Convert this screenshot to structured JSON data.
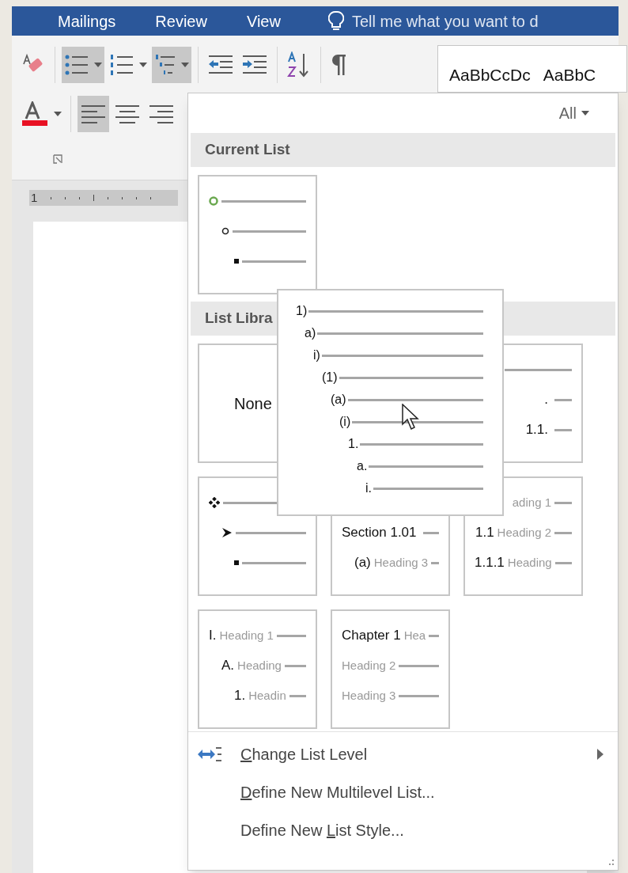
{
  "ribbon": {
    "tabs": [
      {
        "label": "Mailings"
      },
      {
        "label": "Review"
      },
      {
        "label": "View"
      }
    ],
    "tell_me": {
      "placeholder": "Tell me what you want to d"
    },
    "row1": [
      {
        "kind": "clear-format"
      },
      {
        "kind": "separator"
      },
      {
        "kind": "bullets",
        "selected": true
      },
      {
        "kind": "numbering",
        "selected": false
      },
      {
        "kind": "multilevel",
        "selected": true
      },
      {
        "kind": "separator"
      },
      {
        "kind": "decrease-indent"
      },
      {
        "kind": "increase-indent"
      },
      {
        "kind": "separator"
      },
      {
        "kind": "sort"
      },
      {
        "kind": "separator"
      },
      {
        "kind": "pilcrow"
      }
    ],
    "row2": [
      {
        "kind": "font-color"
      },
      {
        "kind": "separator"
      },
      {
        "kind": "align-left",
        "selected": true
      },
      {
        "kind": "align-center",
        "selected": false
      },
      {
        "kind": "align-right",
        "selected": false
      }
    ],
    "styles": [
      "AaBbCcDc",
      "AaBbC"
    ]
  },
  "ruler": {
    "label": "1"
  },
  "menu": {
    "filter": "All",
    "current_header": "Current List",
    "current_list": {
      "rows": [
        {
          "kind": "ring-green",
          "children": [
            {
              "kind": "ring",
              "children": [
                {
                  "kind": "square"
                }
              ]
            }
          ]
        }
      ]
    },
    "library_header": "List Libra",
    "library": [
      {
        "kind": "none",
        "label": "None"
      },
      {
        "kind": "covered"
      },
      {
        "kind": "rows-right",
        "rows": [
          {},
          {
            "number": "."
          },
          {
            "number": "1.1."
          }
        ]
      },
      {
        "kind": "rows",
        "rows": [
          {
            "kind": "diamond",
            "children": [
              {
                "kind": "arrow",
                "children": [
                  {
                    "kind": "square"
                  }
                ]
              }
            ]
          }
        ]
      },
      {
        "kind": "rows",
        "rows": [
          {},
          {
            "number": "Section 1.01",
            "children": [
              {
                "number": "(a)",
                "heading": "Heading 3"
              }
            ]
          }
        ]
      },
      {
        "kind": "rows-right",
        "rows": [
          {
            "heading": "ading 1"
          },
          {
            "number": "1.1",
            "heading": "Heading 2"
          },
          {
            "number": "1.1.1",
            "heading": "Heading"
          }
        ]
      },
      {
        "kind": "rows",
        "rows": [
          {
            "number": "I.",
            "heading": "Heading 1",
            "children": [
              {
                "number": "A.",
                "heading": "Heading",
                "children": [
                  {
                    "number": "1.",
                    "heading": "Headin"
                  }
                ]
              }
            ]
          }
        ]
      },
      {
        "kind": "rows",
        "rows": [
          {
            "number": "Chapter 1",
            "heading": "Hea"
          },
          {
            "heading": "Heading 2"
          },
          {
            "heading": "Heading 3"
          }
        ]
      }
    ],
    "actions": [
      {
        "kind": "submenu",
        "accel": "C",
        "after": "hange List Level"
      },
      {
        "kind": "plain",
        "accel": "D",
        "after": "efine New Multilevel List..."
      },
      {
        "kind": "plain",
        "before": "Define New ",
        "accel": "L",
        "after": "ist Style..."
      }
    ]
  },
  "preview": {
    "levels": [
      {
        "number": "1)",
        "children": [
          {
            "number": "a)",
            "children": [
              {
                "number": "i)",
                "children": [
                  {
                    "number": "(1)",
                    "children": [
                      {
                        "number": "(a)",
                        "children": [
                          {
                            "number": "(i)",
                            "children": [
                              {
                                "number": "1.",
                                "children": [
                                  {
                                    "number": "a.",
                                    "children": [
                                      {
                                        "number": "i."
                                      }
                                    ]
                                  }
                                ]
                              }
                            ]
                          }
                        ]
                      }
                    ]
                  }
                ]
              }
            ]
          }
        ]
      }
    ]
  }
}
